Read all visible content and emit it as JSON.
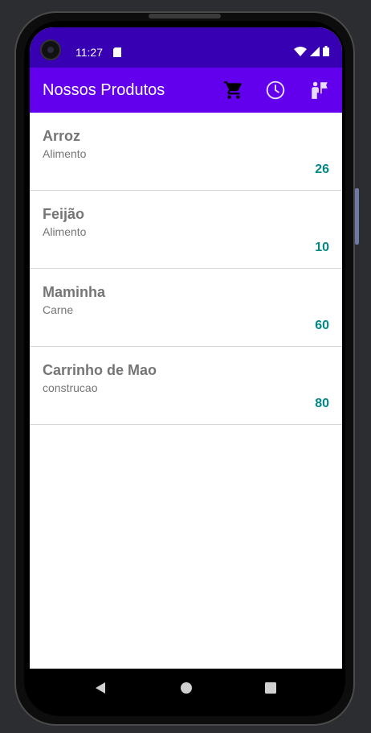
{
  "status_bar": {
    "time": "11:27",
    "icons": [
      "camera-icon",
      "sd-card-icon",
      "wifi-icon",
      "signal-icon",
      "battery-icon"
    ]
  },
  "app_bar": {
    "title": "Nossos Produtos",
    "actions": [
      "cart-icon",
      "clock-icon",
      "user-flag-icon"
    ],
    "background": "#6200ee",
    "status_background": "#3700b3"
  },
  "products": [
    {
      "name": "Arroz",
      "category": "Alimento",
      "quantity": "26"
    },
    {
      "name": "Feijão",
      "category": "Alimento",
      "quantity": "10"
    },
    {
      "name": "Maminha",
      "category": "Carne",
      "quantity": "60"
    },
    {
      "name": "Carrinho de Mao",
      "category": "construcao",
      "quantity": "80"
    }
  ],
  "colors": {
    "quantity": "#018786",
    "text_secondary": "#757575"
  },
  "nav_bar": {
    "buttons": [
      "back-icon",
      "home-icon",
      "recents-icon"
    ]
  }
}
